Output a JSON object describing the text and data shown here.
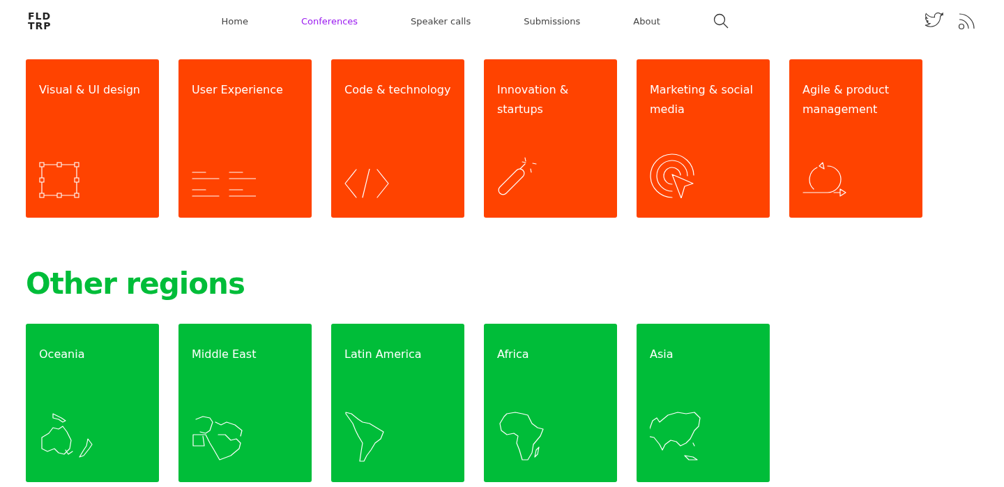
{
  "header": {
    "logo": [
      "FLD",
      "TRP"
    ],
    "nav": [
      {
        "label": "Home",
        "selected": false
      },
      {
        "label": "Conferences",
        "selected": true
      },
      {
        "label": "Speaker calls",
        "selected": false
      },
      {
        "label": "Submissions",
        "selected": false
      },
      {
        "label": "About",
        "selected": false
      }
    ]
  },
  "topics": [
    {
      "title": "Visual & UI design",
      "kind": "selection"
    },
    {
      "title": "User Experience",
      "kind": "lines"
    },
    {
      "title": "Code & technology",
      "kind": "code"
    },
    {
      "title": "Innovation & startups",
      "kind": "firecracker"
    },
    {
      "title": "Marketing & social media",
      "kind": "target"
    },
    {
      "title": "Agile & product management",
      "kind": "cycle"
    }
  ],
  "regions_heading": "Other regions",
  "regions": [
    {
      "title": "Oceania",
      "kind": "oceania"
    },
    {
      "title": "Middle East",
      "kind": "middle-east"
    },
    {
      "title": "Latin America",
      "kind": "latin-america"
    },
    {
      "title": "Africa",
      "kind": "africa"
    },
    {
      "title": "Asia",
      "kind": "asia"
    }
  ]
}
